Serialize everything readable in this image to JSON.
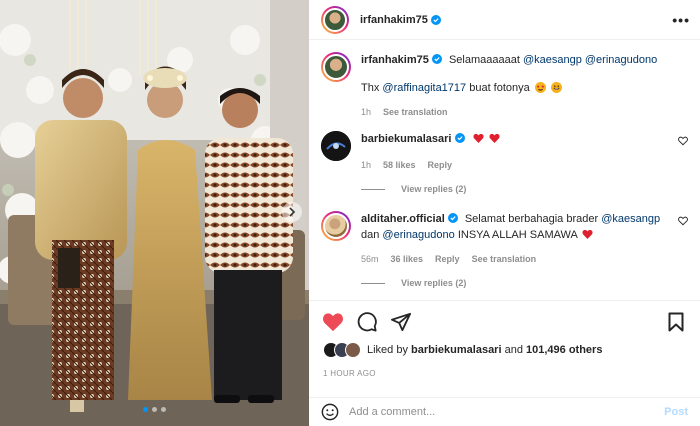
{
  "post": {
    "username": "irfanhakim75",
    "more_label": "•••",
    "icons": [
      "verified-badge-icon",
      "more-options-icon",
      "carousel-next-icon"
    ]
  },
  "comments": [
    {
      "username": "irfanhakim75",
      "text_parts": [
        "Selamaaaaaat ",
        "@kaesangp",
        " ",
        "@erinagudono"
      ],
      "text2_parts": [
        "Thx ",
        "@raffinagita1717",
        " buat fotonya"
      ],
      "time": "1h",
      "see_translation": "See translation"
    },
    {
      "username": "barbiekumalasari",
      "time": "1h",
      "likes": "58 likes",
      "reply": "Reply",
      "view_replies": "View replies (2)"
    },
    {
      "username": "alditaher.official",
      "text_parts": [
        "Selamat berbahagia brader ",
        "@kaesangp"
      ],
      "text2_parts": [
        "dan ",
        "@erinagudono",
        " INSYA ALLAH SAMAWA "
      ],
      "time": "56m",
      "likes": "36 likes",
      "reply": "Reply",
      "see_translation": "See translation",
      "view_replies": "View replies (2)"
    }
  ],
  "likes_summary": {
    "prefix": "Liked by ",
    "user": "barbiekumalasari",
    "middle": " and ",
    "count": "101,496 others"
  },
  "time_ago": "1 HOUR AGO",
  "add_comment": {
    "placeholder": "Add a comment...",
    "post_label": "Post"
  },
  "colors": {
    "link": "#00376b",
    "like_red": "#ed4956",
    "verified_blue": "#0095f6",
    "muted": "#8e8e8e"
  }
}
